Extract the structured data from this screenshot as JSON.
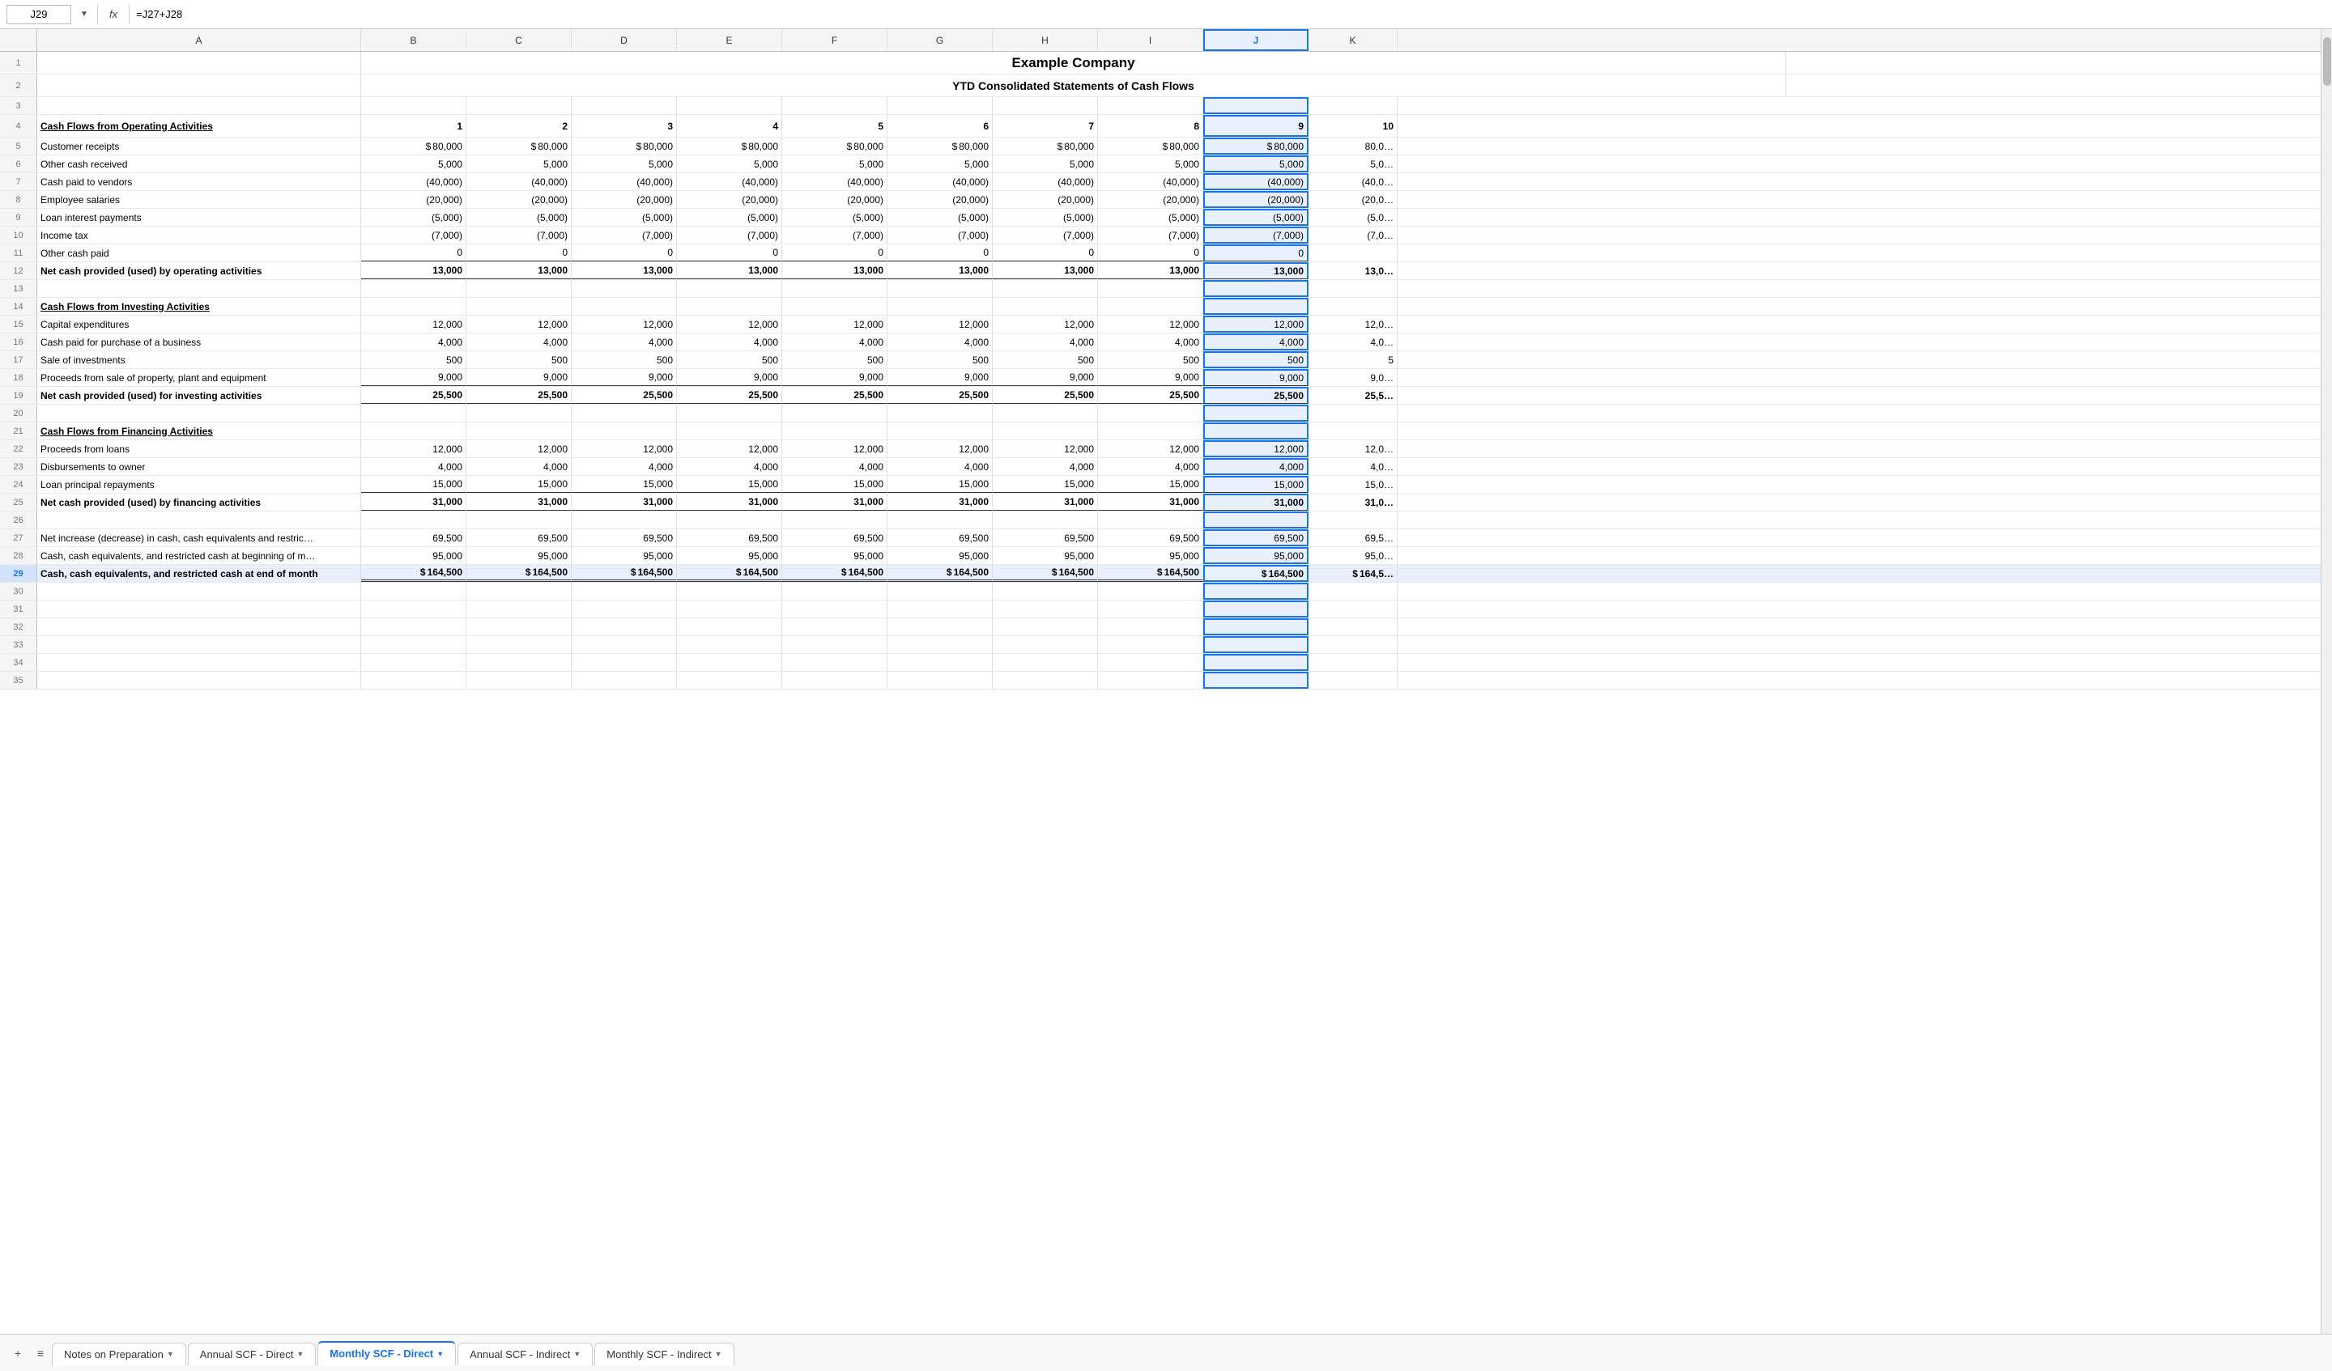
{
  "formula_bar": {
    "cell_ref": "J29",
    "formula": "=J27+J28"
  },
  "header": {
    "company": "Example Company",
    "subtitle": "YTD Consolidated Statements of Cash Flows"
  },
  "columns": {
    "row_num": "",
    "a": "A",
    "b": "B",
    "c": "C",
    "d": "D",
    "e": "E",
    "f": "F",
    "g": "G",
    "h": "H",
    "i": "I",
    "j": "J",
    "k": "K"
  },
  "col_numbers": [
    "1",
    "2",
    "3",
    "4",
    "5",
    "6",
    "7",
    "8",
    "9",
    "10"
  ],
  "rows": {
    "operating_label": "Cash Flows from Operating Activities",
    "customer_receipts": "Customer receipts",
    "other_cash_received": "Other cash received",
    "cash_paid_vendors": "Cash paid to vendors",
    "employee_salaries": "Employee salaries",
    "loan_interest": "Loan interest payments",
    "income_tax": "Income tax",
    "other_cash_paid": "Other cash paid",
    "net_operating": "Net cash provided (used) by operating activities",
    "investing_label": "Cash Flows from Investing Activities",
    "capital_exp": "Capital expenditures",
    "cash_purchase_biz": "Cash paid for purchase of a business",
    "sale_investments": "Sale of investments",
    "proceeds_sale": "Proceeds from sale of property, plant and equipment",
    "net_investing": "Net cash provided (used) for investing activities",
    "financing_label": "Cash Flows from Financing Activities",
    "proceeds_loans": "Proceeds from loans",
    "disbursements": "Disbursements to owner",
    "loan_principal": "Loan principal repayments",
    "net_financing": "Net cash provided (used) by financing activities",
    "net_increase": "Net increase (decrease) in cash, cash equivalents and restric…",
    "beginning_cash": "Cash, cash equivalents, and restricted cash at beginning of m…",
    "ending_cash": "Cash, cash equivalents, and restricted cash at end of month"
  },
  "values": {
    "customer_receipts": 80000,
    "other_cash_received": 5000,
    "cash_paid_vendors": -40000,
    "employee_salaries": -20000,
    "loan_interest": -5000,
    "income_tax": -7000,
    "other_cash_paid": 0,
    "net_operating": 13000,
    "capital_exp": 12000,
    "cash_purchase_biz": 4000,
    "sale_investments": 500,
    "proceeds_sale": 9000,
    "net_investing": 25500,
    "proceeds_loans": 12000,
    "disbursements": 4000,
    "loan_principal": 15000,
    "net_financing": 31000,
    "net_increase": 69500,
    "beginning_cash": 95000,
    "ending_cash": 164500
  },
  "tabs": {
    "add_label": "+",
    "menu_label": "≡",
    "notes": "Notes on Preparation",
    "annual_direct": "Annual SCF - Direct",
    "monthly_direct": "Monthly SCF - Direct",
    "annual_indirect": "Annual SCF - Indirect",
    "monthly_indirect": "Monthly SCF - Indirect"
  }
}
